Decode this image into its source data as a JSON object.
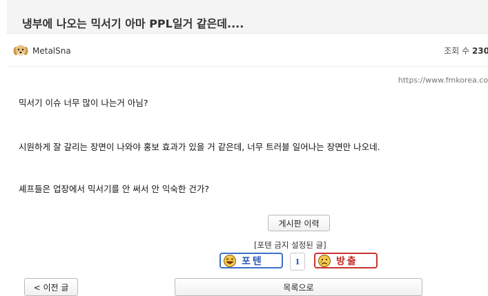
{
  "post": {
    "title": "냉부에 나오는 믹서기 아마 PPL일거 같은데....",
    "author": "MetalSna",
    "views_label": "조회 수",
    "views_value": "230",
    "source_url": "https://www.fmkorea.co",
    "body_lines": [
      "믹서기 이슈 너무 많이 나는거 아님?",
      "시원하게 잘 갈리는 장면이 나와야 홍보 효과가 있을 거 같은데, 너무 트러블 일어나는 장면만 나오네.",
      "셰프들은 업장에서 믹서기를 안 써서 안 익숙한 건가?"
    ]
  },
  "actions": {
    "board_history": "게시판 이력",
    "notice": "[포텐 금지 설정된 글]",
    "upvote_label": "포텐",
    "vote_count": "1",
    "downvote_label": "방출",
    "prev_post": "< 이전 글",
    "list": "목록으로"
  },
  "icons": {
    "avatar": "puppy-avatar-icon",
    "upvote": "laughing-face-icon",
    "downvote": "crying-face-icon"
  },
  "colors": {
    "upvote": "#3b6fc9",
    "downvote": "#c8322e"
  }
}
